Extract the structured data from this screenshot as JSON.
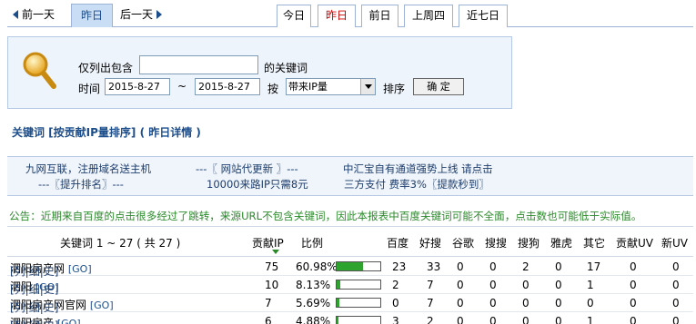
{
  "nav": {
    "prev": "前一天",
    "current": "昨日",
    "next": "后一天",
    "tabs": [
      "今日",
      "昨日",
      "前日",
      "上周四",
      "近七日"
    ]
  },
  "filter": {
    "only_label": "仅列出包含",
    "only_value": "",
    "only_suffix": "的关键词",
    "time_label": "时间",
    "date_from": "2015-8-27",
    "range_sep": "~",
    "date_to": "2015-8-27",
    "by_label": "按",
    "sort_selected": "带来IP量",
    "sort_label": "排序",
    "confirm": "确 定"
  },
  "section_title": "关键词 [按贡献IP量排序] ( 昨日详情 )",
  "ads": {
    "a1": "九网互联，注册域名送主机",
    "a2": "---〖提升排名〗---",
    "a3": "---〖 网站代更新 〗---",
    "a4": "10000来路IP只需8元",
    "a5": "中汇宝自有通道强势上线 请点击",
    "a6": "三方支付 费率3%〖提款秒到〗"
  },
  "notice": "公告：近期来自百度的点击很多经过了跳转，来源URL不包含关键词，因此本报表中百度关键词可能不全面，点击数也可能低于实际值。",
  "table": {
    "headers": [
      "关键词 1 ~ 27 ( 共 27 )",
      "贡献IP",
      "比例",
      "百度",
      "好搜",
      "谷歌",
      "搜搜",
      "搜狗",
      "雅虎",
      "其它",
      "贡献UV",
      "新UV"
    ],
    "rows": [
      {
        "links": "[列|细|史]",
        "keyword": "泗阳房产网",
        "go": "[GO]",
        "ip": "75",
        "pct": "60.98%",
        "ratio": 0.6098,
        "c": [
          "23",
          "33",
          "0",
          "0",
          "2",
          "0",
          "17",
          "0",
          "0"
        ]
      },
      {
        "links": "[列|细|史]",
        "keyword": "泗阳",
        "go": "[GO]",
        "ip": "10",
        "pct": "8.13%",
        "ratio": 0.0813,
        "c": [
          "2",
          "7",
          "0",
          "0",
          "0",
          "0",
          "1",
          "0",
          "0"
        ]
      },
      {
        "links": "[列|细|史]",
        "keyword": "泗阳房产网官网",
        "go": "[GO]",
        "ip": "7",
        "pct": "5.69%",
        "ratio": 0.0569,
        "c": [
          "0",
          "7",
          "0",
          "0",
          "0",
          "0",
          "0",
          "0",
          "0"
        ]
      },
      {
        "links": "[列|细|史]",
        "keyword": "泗阳房产",
        "go": "[GO]",
        "ip": "6",
        "pct": "4.88%",
        "ratio": 0.0488,
        "c": [
          "3",
          "2",
          "0",
          "0",
          "0",
          "0",
          "1",
          "0",
          "0"
        ]
      }
    ]
  }
}
